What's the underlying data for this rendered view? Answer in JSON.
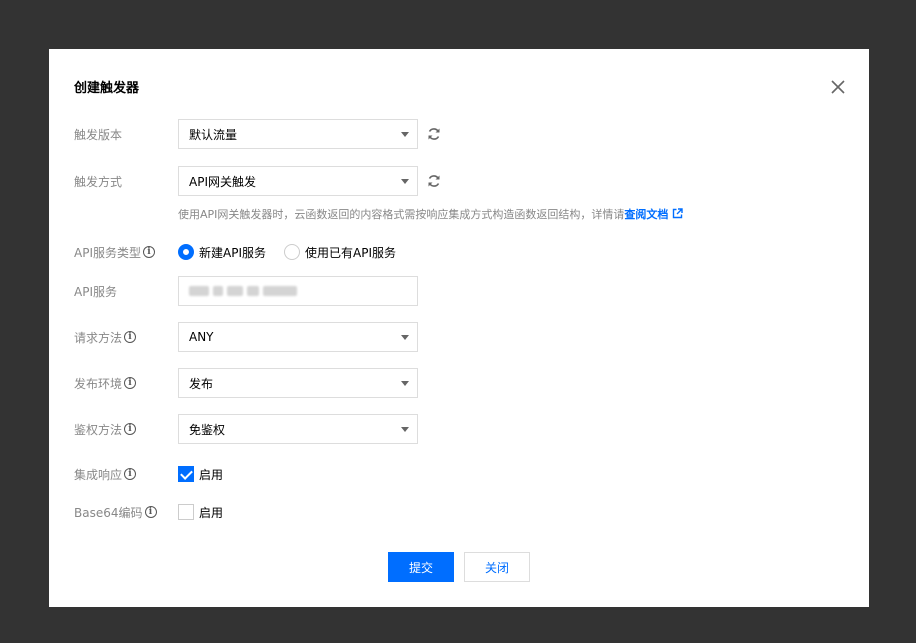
{
  "dialog": {
    "title": "创建触发器"
  },
  "form": {
    "version": {
      "label": "触发版本",
      "value": "默认流量"
    },
    "method": {
      "label": "触发方式",
      "value": "API网关触发"
    },
    "hint": {
      "text": "使用API网关触发器时，云函数返回的内容格式需按响应集成方式构造函数返回结构，详情请",
      "link": "查阅文档"
    },
    "service_type": {
      "label": "API服务类型",
      "options": [
        "新建API服务",
        "使用已有API服务"
      ],
      "selected": "新建API服务"
    },
    "service": {
      "label": "API服务"
    },
    "request_method": {
      "label": "请求方法",
      "value": "ANY"
    },
    "env": {
      "label": "发布环境",
      "value": "发布"
    },
    "auth": {
      "label": "鉴权方法",
      "value": "免鉴权"
    },
    "integration": {
      "label": "集成响应",
      "checkbox_label": "启用",
      "checked": true
    },
    "base64": {
      "label": "Base64编码",
      "checkbox_label": "启用",
      "checked": false
    }
  },
  "footer": {
    "submit_label": "提交",
    "close_label": "关闭"
  },
  "colors": {
    "accent": "#006eff",
    "overlay": "#333333"
  },
  "icons": {
    "close": "close-icon",
    "refresh": "refresh-icon",
    "info": "info-icon",
    "external": "external-link-icon"
  }
}
